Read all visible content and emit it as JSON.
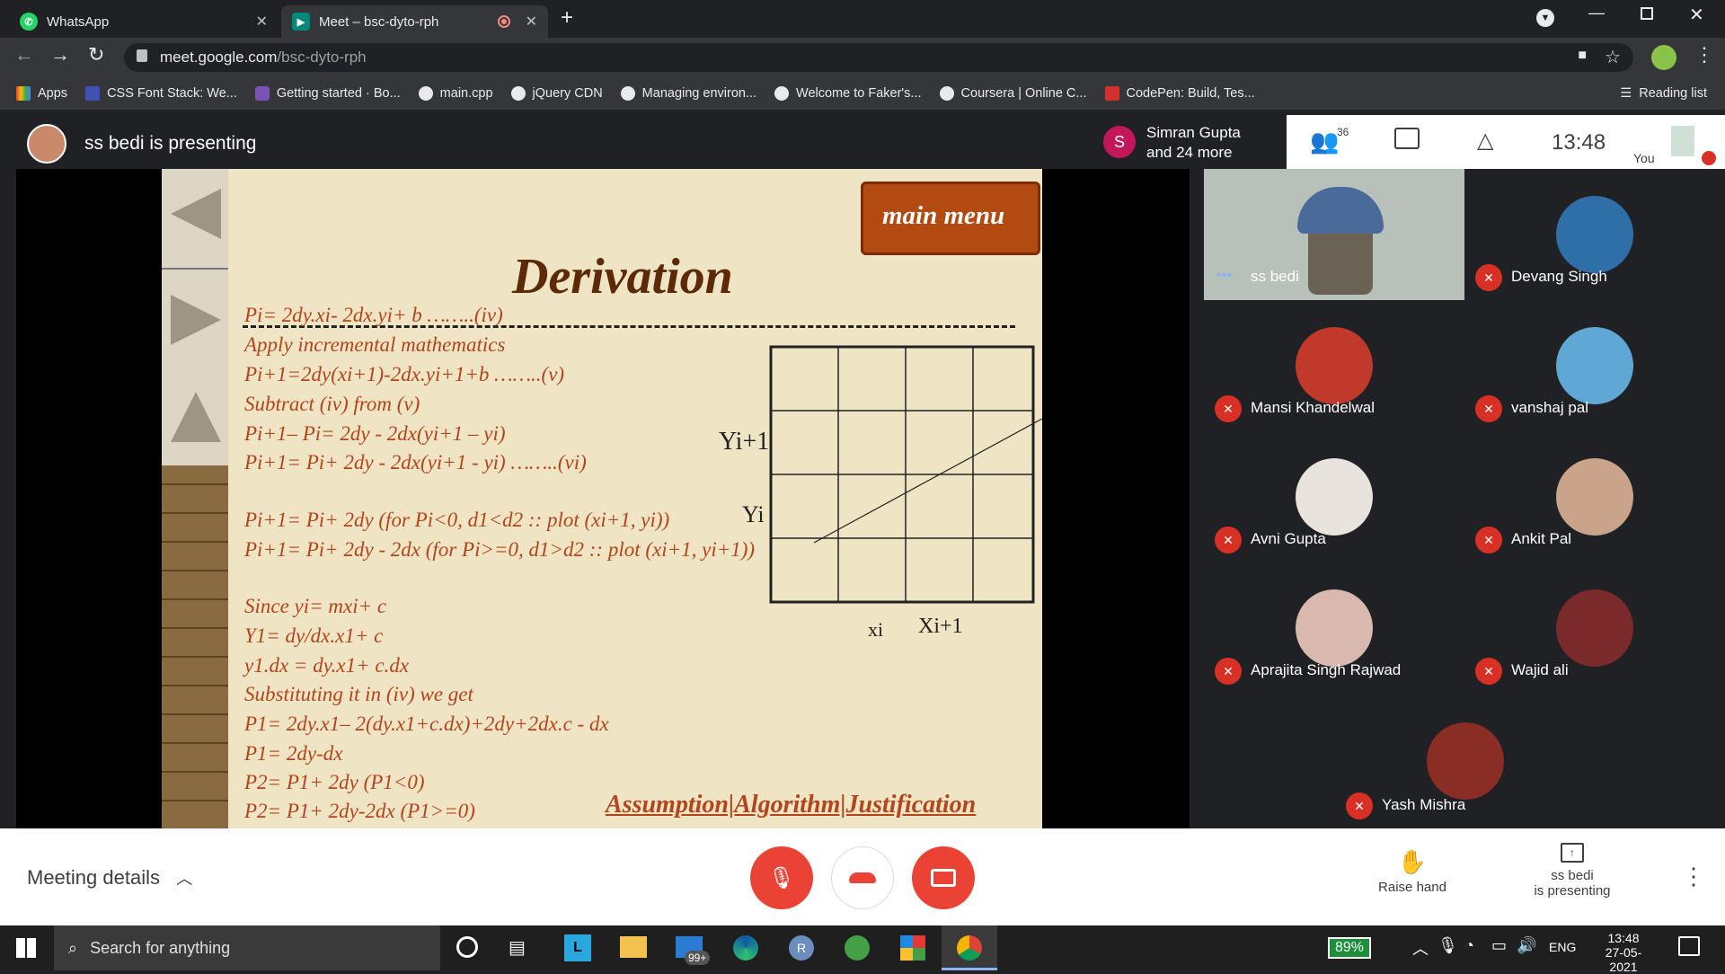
{
  "tabs": [
    {
      "title": "WhatsApp"
    },
    {
      "title": "Meet – bsc-dyto-rph"
    }
  ],
  "address": {
    "host": "meet.google.com",
    "path": "/bsc-dyto-rph"
  },
  "bookmarks": [
    "Apps",
    "CSS Font Stack: We...",
    "Getting started · Bo...",
    "main.cpp",
    "jQuery CDN",
    "Managing environ...",
    "Welcome to Faker's...",
    "Coursera | Online C...",
    "CodePen: Build, Tes..."
  ],
  "reading_list": "Reading list",
  "meet": {
    "presenting_label": "ss bedi is presenting",
    "participants_summary": {
      "initial": "S",
      "line1": "Simran Gupta",
      "line2": "and 24 more"
    },
    "participant_count": "36",
    "time": "13:48",
    "you_label": "You",
    "meeting_details": "Meeting details",
    "raise_hand": "Raise hand",
    "presenting_line1": "ss bedi",
    "presenting_line2": "is presenting",
    "tiles": [
      {
        "name": "ss bedi"
      },
      {
        "name": "Devang Singh"
      },
      {
        "name": "Mansi Khandelwal"
      },
      {
        "name": "vanshaj pal"
      },
      {
        "name": "Avni Gupta"
      },
      {
        "name": "Ankit Pal"
      },
      {
        "name": "Aprajita Singh Rajwad"
      },
      {
        "name": "Wajid ali"
      },
      {
        "name": "Yash Mishra"
      }
    ]
  },
  "slide": {
    "main_menu": "main menu",
    "title": "Derivation",
    "lines": [
      "Pi= 2dy.xi- 2dx.yi+ b ……..(iv)",
      "Apply incremental mathematics",
      "Pi+1=2dy(xi+1)-2dx.yi+1+b ……..(v)",
      "Subtract (iv) from (v)",
      "Pi+1– Pi= 2dy - 2dx(yi+1 – yi)",
      "Pi+1= Pi+ 2dy - 2dx(yi+1 - yi) ……..(vi)",
      "Pi+1= Pi+ 2dy (for Pi<0, d1<d2 :: plot (xi+1, yi))",
      "Pi+1= Pi+ 2dy - 2dx (for Pi>=0, d1>d2 :: plot (xi+1, yi+1))",
      "Since yi= mxi+ c",
      "Y1= dy/dx.x1+ c",
      "y1.dx = dy.x1+ c.dx",
      "Substituting it in (iv) we get",
      "P1= 2dy.x1– 2(dy.x1+c.dx)+2dy+2dx.c - dx",
      "P1= 2dy-dx",
      "P2= P1+ 2dy (P1<0)",
      "P2= P1+ 2dy-2dx (P1>=0)"
    ],
    "grid_labels": {
      "yi1": "Yi+1",
      "yi": "Yi",
      "xi": "xi",
      "xi1": "Xi+1"
    },
    "footer_links": "Assumption|Algorithm|Justification"
  },
  "taskbar": {
    "search": "Search for anything",
    "badge": "99+",
    "battery": "89%",
    "lang": "ENG",
    "time": "13:48",
    "date": "27-05-2021"
  }
}
